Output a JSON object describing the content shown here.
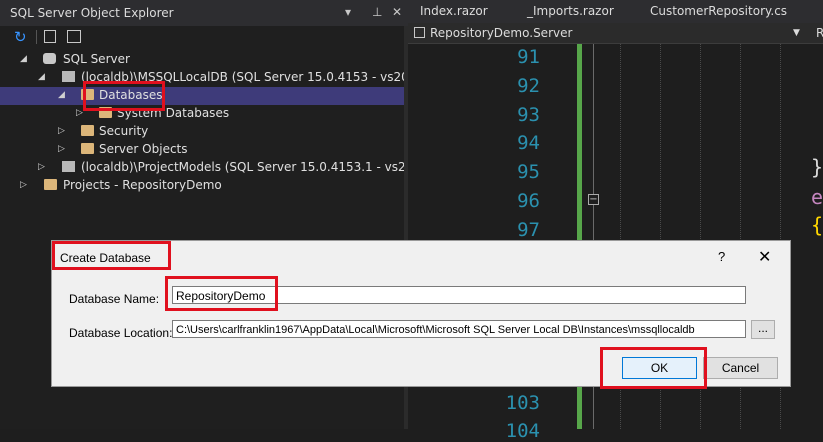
{
  "explorer": {
    "title": "SQL Server Object Explorer",
    "pin_glyph": "▾",
    "pin2_glyph": "⊥",
    "close_glyph": "✕",
    "tree": [
      {
        "label": "SQL Server"
      },
      {
        "label": "(localdb)\\MSSQLLocalDB (SQL Server 15.0.4153 - vs2022-win1"
      },
      {
        "label": "Databases"
      },
      {
        "label": "System Databases"
      },
      {
        "label": "Security"
      },
      {
        "label": "Server Objects"
      },
      {
        "label": "(localdb)\\ProjectModels (SQL Server 15.0.4153.1 - vs2022-win"
      },
      {
        "label": "Projects - RepositoryDemo"
      }
    ]
  },
  "editor": {
    "tabs": [
      "Index.razor",
      "_Imports.razor",
      "CustomerRepository.cs"
    ],
    "breadcrumb": "RepositoryDemo.Server",
    "breadcrumb_right": "R",
    "line_numbers": [
      "91",
      "92",
      "93",
      "94",
      "95",
      "96",
      "97",
      "103",
      "104"
    ],
    "code_glyphs": [
      "}",
      "e",
      "{"
    ]
  },
  "dialog": {
    "title": "Create Database",
    "help": "?",
    "close": "✕",
    "name_label": "Database Name:",
    "name_value": "RepositoryDemo",
    "location_label": "Database Location:",
    "location_value": "C:\\Users\\carlfranklin1967\\AppData\\Local\\Microsoft\\Microsoft SQL Server Local DB\\Instances\\mssqllocaldb",
    "browse_label": "...",
    "ok_label": "OK",
    "cancel_label": "Cancel"
  },
  "colors": {
    "highlight": "#e0101e",
    "selection": "#3e3b7a",
    "line_number": "#2b91af",
    "change_bar": "#57a64a"
  }
}
